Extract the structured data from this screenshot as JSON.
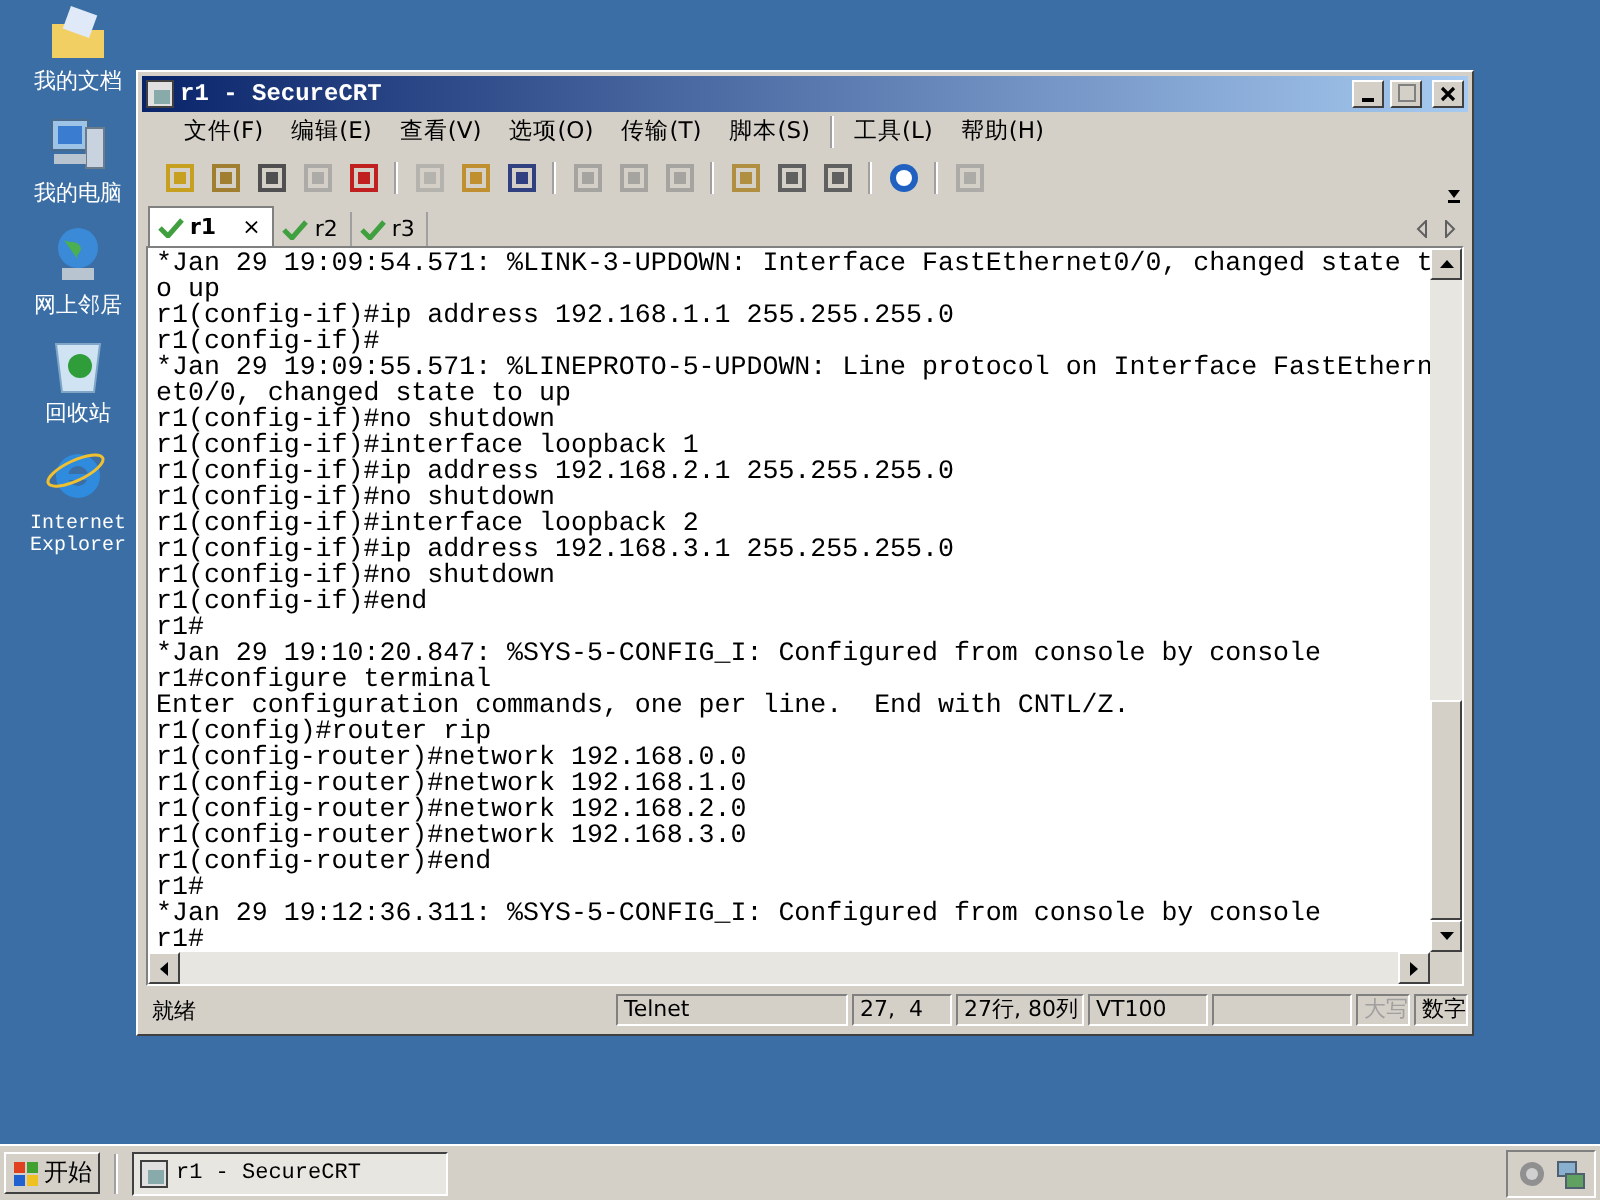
{
  "desktop_icons": [
    {
      "label": "我的文档"
    },
    {
      "label": "我的电脑"
    },
    {
      "label": "网上邻居"
    },
    {
      "label": "回收站"
    },
    {
      "label": "Internet Explorer"
    }
  ],
  "window": {
    "title": "r1 - SecureCRT"
  },
  "menu": [
    "文件(F)",
    "编辑(E)",
    "查看(V)",
    "选项(O)",
    "传输(T)",
    "脚本(S)",
    "工具(L)",
    "帮助(H)"
  ],
  "toolbar": [
    {
      "disabled": false
    },
    {
      "disabled": false
    },
    {
      "disabled": false
    },
    {
      "disabled": true
    },
    {
      "disabled": false
    },
    {
      "disabled": true
    },
    {
      "disabled": false
    },
    {
      "disabled": false
    },
    {
      "disabled": true
    },
    {
      "disabled": true
    },
    {
      "disabled": true
    },
    {
      "disabled": false
    },
    {
      "disabled": false
    },
    {
      "disabled": false
    },
    {
      "disabled": false
    },
    {
      "disabled": true
    }
  ],
  "tabs": [
    {
      "label": "r1",
      "selected": true,
      "close": "×"
    },
    {
      "label": "r2",
      "selected": false
    },
    {
      "label": "r3",
      "selected": false
    }
  ],
  "terminal_lines": [
    "*Jan 29 19:09:54.571: %LINK-3-UPDOWN: Interface FastEthernet0/0, changed state t",
    "o up",
    "r1(config-if)#ip address 192.168.1.1 255.255.255.0",
    "r1(config-if)#",
    "*Jan 29 19:09:55.571: %LINEPROTO-5-UPDOWN: Line protocol on Interface FastEthern",
    "et0/0, changed state to up",
    "r1(config-if)#no shutdown",
    "r1(config-if)#interface loopback 1",
    "r1(config-if)#ip address 192.168.2.1 255.255.255.0",
    "r1(config-if)#no shutdown",
    "r1(config-if)#interface loopback 2",
    "r1(config-if)#ip address 192.168.3.1 255.255.255.0",
    "r1(config-if)#no shutdown",
    "r1(config-if)#end",
    "r1#",
    "*Jan 29 19:10:20.847: %SYS-5-CONFIG_I: Configured from console by console",
    "r1#configure terminal",
    "Enter configuration commands, one per line.  End with CNTL/Z.",
    "r1(config)#router rip",
    "r1(config-router)#network 192.168.0.0",
    "r1(config-router)#network 192.168.1.0",
    "r1(config-router)#network 192.168.2.0",
    "r1(config-router)#network 192.168.3.0",
    "r1(config-router)#end",
    "r1#",
    "*Jan 29 19:12:36.311: %SYS-5-CONFIG_I: Configured from console by console",
    "r1#"
  ],
  "status_bar": {
    "message": "就绪",
    "fields": [
      {
        "text": "Telnet"
      },
      {
        "text": "27,  4"
      },
      {
        "text": "27行, 80列"
      },
      {
        "text": "VT100"
      }
    ],
    "indicators": [
      {
        "text": "大写",
        "disabled": true
      },
      {
        "text": "数字",
        "disabled": false
      }
    ]
  },
  "taskbar": {
    "start": "开始",
    "tasks": [
      {
        "label": "r1 - SecureCRT",
        "selected": true
      }
    ]
  }
}
